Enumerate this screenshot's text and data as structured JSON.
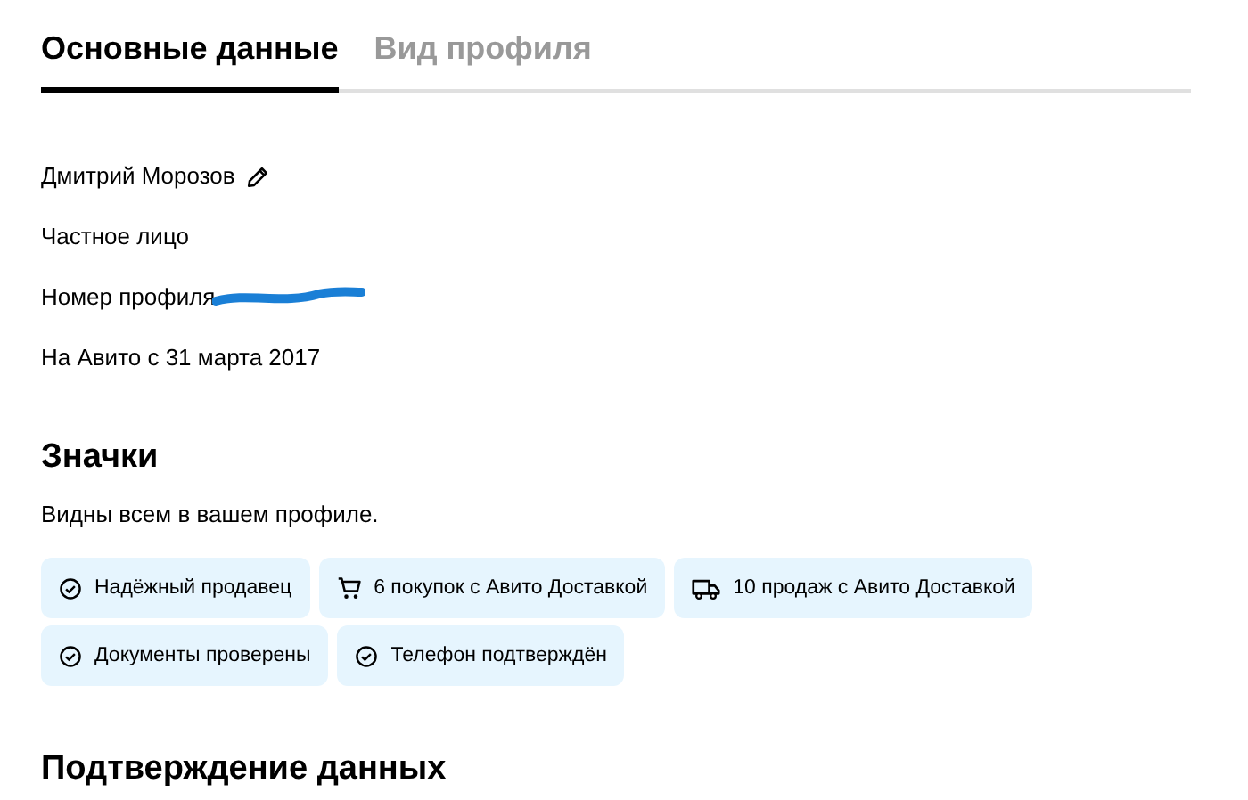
{
  "tabs": [
    {
      "label": "Основные данные",
      "selected": true
    },
    {
      "label": "Вид профиля",
      "selected": false
    }
  ],
  "profile": {
    "name": "Дмитрий Морозов",
    "type": "Частное лицо",
    "number_label": "Номер профиля",
    "number_redacted": true,
    "since": "На Авито с 31 марта 2017"
  },
  "badges_section": {
    "title": "Значки",
    "subtitle": "Видны всем в вашем профиле.",
    "badges": [
      {
        "kind": "check",
        "label": "Надёжный продавец"
      },
      {
        "kind": "cart",
        "label": "6 покупок с Авито Доставкой"
      },
      {
        "kind": "truck",
        "label": "10 продаж с Авито Доставкой"
      },
      {
        "kind": "check",
        "label": "Документы проверены"
      },
      {
        "kind": "check",
        "label": "Телефон подтверждён"
      }
    ]
  },
  "next_section": {
    "title": "Подтверждение данных"
  }
}
